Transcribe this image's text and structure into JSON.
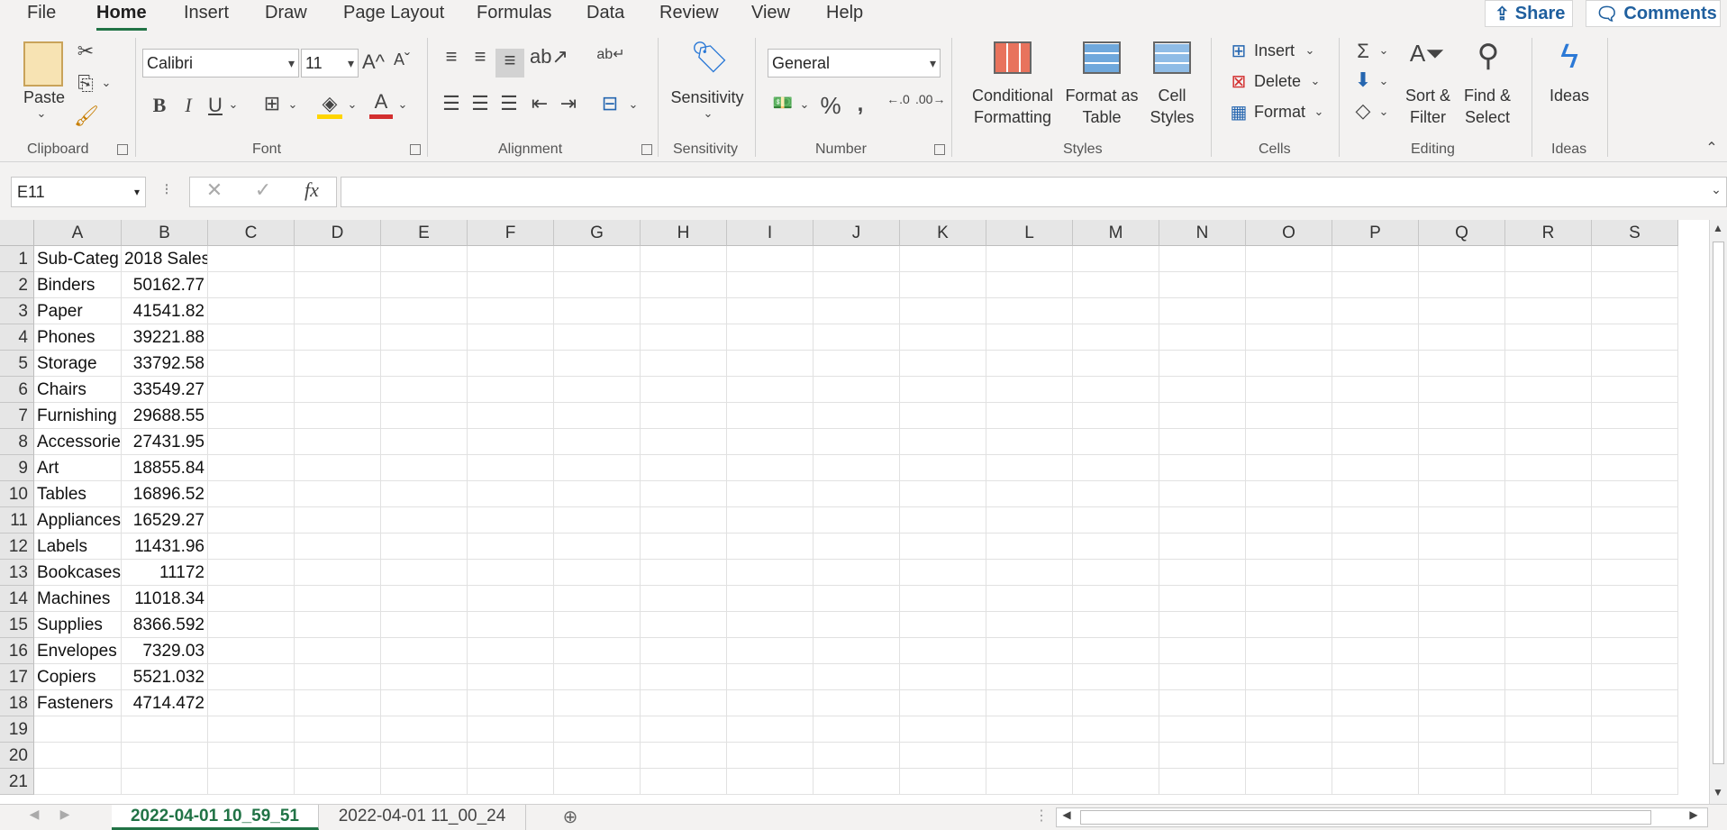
{
  "menu": {
    "tabs": [
      "File",
      "Home",
      "Insert",
      "Draw",
      "Page Layout",
      "Formulas",
      "Data",
      "Review",
      "View",
      "Help"
    ],
    "active_tab": "Home",
    "share_label": "Share",
    "comments_label": "Comments"
  },
  "ribbon": {
    "clipboard": {
      "paste": "Paste",
      "label": "Clipboard"
    },
    "font": {
      "name": "Calibri",
      "size": "11",
      "bold": "B",
      "italic": "I",
      "underline": "U",
      "label": "Font"
    },
    "alignment": {
      "label": "Alignment"
    },
    "sensitivity": {
      "button": "Sensitivity",
      "label": "Sensitivity"
    },
    "number": {
      "format": "General",
      "label": "Number"
    },
    "styles": {
      "conditional": [
        "Conditional",
        "Formatting"
      ],
      "format_table": [
        "Format as",
        "Table"
      ],
      "cell_styles": [
        "Cell",
        "Styles"
      ],
      "label": "Styles"
    },
    "cells": {
      "insert": "Insert",
      "delete": "Delete",
      "format": "Format",
      "label": "Cells"
    },
    "editing": {
      "sort": [
        "Sort &",
        "Filter"
      ],
      "find": [
        "Find &",
        "Select"
      ],
      "label": "Editing"
    },
    "ideas": {
      "button": "Ideas",
      "label": "Ideas"
    }
  },
  "formula_bar": {
    "name_box": "E11",
    "fx": "fx",
    "value": ""
  },
  "columns": [
    "A",
    "B",
    "C",
    "D",
    "E",
    "F",
    "G",
    "H",
    "I",
    "J",
    "K",
    "L",
    "M",
    "N",
    "O",
    "P",
    "Q",
    "R",
    "S"
  ],
  "rows": [
    [
      "Sub-Categ",
      "2018 Sales"
    ],
    [
      "Binders",
      "50162.77"
    ],
    [
      "Paper",
      "41541.82"
    ],
    [
      "Phones",
      "39221.88"
    ],
    [
      "Storage",
      "33792.58"
    ],
    [
      "Chairs",
      "33549.27"
    ],
    [
      "Furnishing",
      "29688.55"
    ],
    [
      "Accessorie",
      "27431.95"
    ],
    [
      "Art",
      "18855.84"
    ],
    [
      "Tables",
      "16896.52"
    ],
    [
      "Appliances",
      "16529.27"
    ],
    [
      "Labels",
      "11431.96"
    ],
    [
      "Bookcases",
      "11172"
    ],
    [
      "Machines",
      "11018.34"
    ],
    [
      "Supplies",
      "8366.592"
    ],
    [
      "Envelopes",
      "7329.03"
    ],
    [
      "Copiers",
      "5521.032"
    ],
    [
      "Fasteners",
      "4714.472"
    ],
    [
      "",
      ""
    ],
    [
      "",
      ""
    ],
    [
      "",
      ""
    ]
  ],
  "sheets": [
    "2022-04-01 10_59_51",
    "2022-04-01 11_00_24"
  ],
  "active_sheet": "2022-04-01 10_59_51"
}
